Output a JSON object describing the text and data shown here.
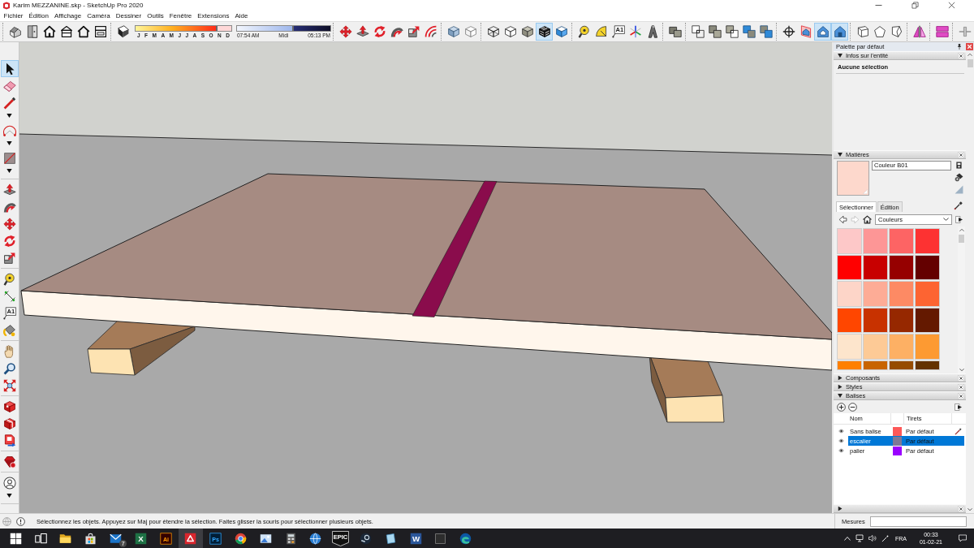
{
  "window": {
    "title": "Karim MEZZANINE.skp - SketchUp Pro 2020"
  },
  "menu": [
    "Fichier",
    "Édition",
    "Affichage",
    "Caméra",
    "Dessiner",
    "Outils",
    "Fenêtre",
    "Extensions",
    "Aide"
  ],
  "toolbar": [
    {
      "kind": "buttons",
      "buttons": [
        {
          "selected": false
        },
        {
          "selected": false
        },
        {
          "selected": false
        },
        {
          "selected": false
        },
        {
          "selected": false
        },
        {
          "selected": false
        }
      ]
    },
    {
      "kind": "shadows",
      "buttons": [
        {
          "selected": false
        }
      ],
      "month_slider": {
        "level": 0.85,
        "labels": [
          "J",
          "F",
          "M",
          "A",
          "M",
          "J",
          "J",
          "A",
          "S",
          "O",
          "N",
          "D"
        ]
      },
      "time_slider": {
        "level": 0.6,
        "labels": [
          "07:54 AM",
          "Midi",
          "05:13 PM"
        ]
      }
    },
    {
      "kind": "buttons",
      "buttons": [
        {
          "selected": false
        },
        {
          "selected": false
        },
        {
          "selected": false
        },
        {
          "selected": false
        },
        {
          "selected": false
        },
        {
          "selected": false
        }
      ]
    },
    {
      "kind": "buttons",
      "buttons": [
        {
          "selected": false
        },
        {
          "selected": false
        }
      ]
    },
    {
      "kind": "buttons",
      "buttons": [
        {
          "selected": false
        },
        {
          "selected": false
        },
        {
          "selected": false
        },
        {
          "selected": true
        },
        {
          "selected": false
        }
      ]
    },
    {
      "kind": "buttons",
      "buttons": [
        {
          "selected": false
        },
        {
          "selected": false
        },
        {
          "selected": false,
          "glyph": "A1"
        },
        {
          "selected": false
        },
        {
          "selected": false
        }
      ]
    },
    {
      "kind": "buttons",
      "buttons": [
        {
          "selected": false
        }
      ]
    },
    {
      "kind": "buttons",
      "buttons": [
        {
          "selected": false
        },
        {
          "selected": false
        },
        {
          "selected": false
        },
        {
          "selected": false
        },
        {
          "selected": false
        }
      ]
    },
    {
      "kind": "buttons",
      "buttons": [
        {
          "selected": false
        },
        {
          "selected": false
        },
        {
          "selected": true
        },
        {
          "selected": true
        }
      ]
    },
    {
      "kind": "buttons",
      "buttons": [
        {
          "selected": false
        },
        {
          "selected": false
        },
        {
          "selected": false
        }
      ]
    },
    {
      "kind": "buttons",
      "buttons": [
        {
          "selected": false
        }
      ]
    },
    {
      "kind": "buttons",
      "buttons": [
        {
          "selected": false
        }
      ]
    },
    {
      "kind": "buttons",
      "buttons": [
        {
          "selected": false
        }
      ]
    }
  ],
  "tool_palette": [
    [
      {
        "selected": true,
        "dropdown": false
      },
      {
        "selected": false,
        "dropdown": false
      },
      {
        "selected": false,
        "dropdown": true
      },
      {
        "selected": false,
        "dropdown": true
      },
      {
        "selected": false,
        "dropdown": true
      }
    ],
    [
      {
        "selected": false,
        "dropdown": false
      },
      {
        "selected": false,
        "dropdown": false
      },
      {
        "selected": false,
        "dropdown": false
      },
      {
        "selected": false,
        "dropdown": false
      },
      {
        "selected": false,
        "dropdown": false
      }
    ],
    [
      {
        "selected": false,
        "dropdown": false
      },
      {
        "selected": false,
        "dropdown": false
      },
      {
        "selected": false,
        "dropdown": false,
        "glyph": "A1"
      },
      {
        "selected": false,
        "dropdown": false
      }
    ],
    [
      {
        "selected": false,
        "dropdown": false
      },
      {
        "selected": false,
        "dropdown": false
      },
      {
        "selected": false,
        "dropdown": false
      }
    ],
    [
      {
        "selected": false,
        "dropdown": false
      },
      {
        "selected": false,
        "dropdown": false
      },
      {
        "selected": false,
        "dropdown": false
      }
    ],
    [
      {
        "selected": false,
        "dropdown": false
      }
    ],
    [
      {
        "selected": false,
        "dropdown": true
      }
    ]
  ],
  "tray": {
    "title": "Palette par défaut",
    "sections": [
      {
        "kind": "entity_info",
        "title": "Infos sur l'entité",
        "expanded": true,
        "text": "Aucune sélection"
      },
      {
        "kind": "materials",
        "title": "Matières",
        "expanded": true,
        "material": {
          "name": "Couleur B01",
          "color": "#fdd8cc"
        },
        "tabs": [
          {
            "label": "Sélectionner",
            "selected": true
          },
          {
            "label": "Édition",
            "selected": false
          }
        ],
        "back": {
          "disabled": false
        },
        "forward": {
          "disabled": true
        },
        "library": "Couleurs",
        "swatches": [
          {
            "color": "#fdc8c8"
          },
          {
            "color": "#fd9696"
          },
          {
            "color": "#fd6464"
          },
          {
            "color": "#fd3232"
          },
          {
            "color": "#ff0000"
          },
          {
            "color": "#c80000"
          },
          {
            "color": "#960000"
          },
          {
            "color": "#640000"
          },
          {
            "color": "#fdd5c8"
          },
          {
            "color": "#fdac96"
          },
          {
            "color": "#fd8a64"
          },
          {
            "color": "#fd6432"
          },
          {
            "color": "#ff4600"
          },
          {
            "color": "#c83200"
          },
          {
            "color": "#962800"
          },
          {
            "color": "#641900"
          },
          {
            "color": "#fde5cc"
          },
          {
            "color": "#fdca96"
          },
          {
            "color": "#fdb064"
          },
          {
            "color": "#fd9a32"
          },
          {
            "color": "#ff8000"
          },
          {
            "color": "#c86400"
          },
          {
            "color": "#964b00"
          },
          {
            "color": "#643200"
          }
        ]
      },
      {
        "kind": "collapsed",
        "title": "Composants",
        "expanded": false
      },
      {
        "kind": "collapsed",
        "title": "Styles",
        "expanded": false
      },
      {
        "kind": "tags",
        "title": "Balises",
        "expanded": true,
        "columns": [
          "Nom",
          "Tirets"
        ],
        "rows": [
          {
            "visible": true,
            "name": "Sans balise",
            "color": "#fd5858",
            "dashes": "Par défaut",
            "selected": false,
            "active": true
          },
          {
            "visible": true,
            "name": "escalier",
            "color": "#7d7896",
            "dashes": "Par défaut",
            "selected": true,
            "active": false
          },
          {
            "visible": true,
            "name": "palier",
            "color": "#9a00ff",
            "dashes": "Par défaut",
            "selected": false,
            "active": false
          }
        ]
      },
      {
        "kind": "collapsed",
        "expanded": false
      }
    ]
  },
  "status_bar": {
    "message": "Sélectionnez les objets. Appuyez sur Maj pour étendre la sélection. Faites glisser la souris pour sélectionner plusieurs objets.",
    "measurements_label": "Mesures"
  },
  "taskbar": {
    "buttons": [
      {
        "active": false
      },
      {
        "active": false
      },
      {
        "active": false
      },
      {
        "active": false
      },
      {
        "active": false,
        "badge": "7"
      },
      {
        "active": false,
        "glyph": "X"
      },
      {
        "active": false,
        "glyph": "Ai"
      },
      {
        "active": true
      },
      {
        "active": false,
        "glyph": "Ps"
      },
      {
        "active": false
      },
      {
        "active": false
      },
      {
        "active": false
      },
      {
        "active": false
      },
      {
        "active": false,
        "glyph": "EPIC"
      },
      {
        "active": false
      },
      {
        "active": false
      },
      {
        "active": false,
        "glyph": "W"
      },
      {
        "active": false
      },
      {
        "active": false
      }
    ],
    "language": "FRA",
    "time": "00:33",
    "date": "01-02-21"
  }
}
